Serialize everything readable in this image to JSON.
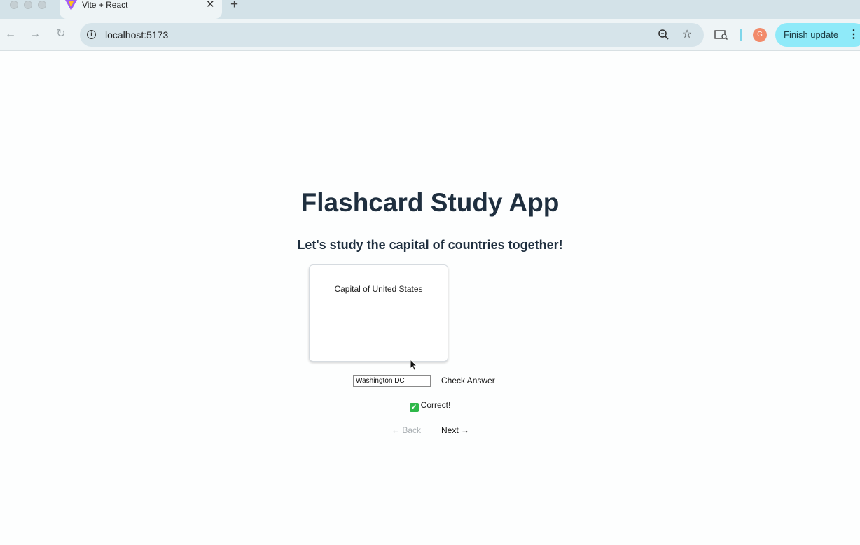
{
  "browser": {
    "tab_title": "Vite + React",
    "tab_close": "✕",
    "new_tab": "+",
    "url": "localhost:5173",
    "avatar_letter": "G",
    "update_label": "Finish update",
    "icons": [
      "back-arrow-icon",
      "forward-arrow-icon",
      "reload-icon",
      "site-info-icon",
      "zoom-icon",
      "bookmark-star-icon",
      "search-tabs-icon",
      "kebab-menu-icon"
    ]
  },
  "app": {
    "title": "Flashcard Study App",
    "subtitle": "Let's study the capital of countries together!",
    "card_prompt": "Capital of United States",
    "answer_value": "Washington DC",
    "check_label": "Check Answer",
    "result_text": "Correct!",
    "result_icon": "✓",
    "back_label": "← Back",
    "next_label": "Next →"
  },
  "colors": {
    "heading": "#1f2f3f",
    "correct_badge": "#2fb84a",
    "update_button": "#8feaf9",
    "disabled_text": "#aab0b4"
  }
}
